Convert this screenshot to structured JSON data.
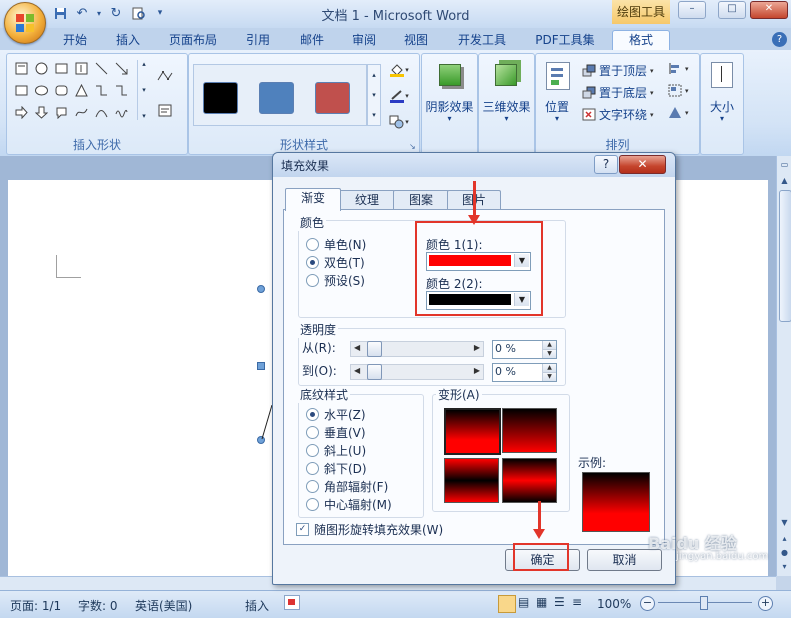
{
  "titlebar": {
    "doc_title": "文档 1 - Microsoft Word",
    "context_tab": "绘图工具",
    "qat_icons": [
      "save-icon",
      "undo-icon",
      "redo-icon",
      "print-preview-icon",
      "customize-qat-icon"
    ],
    "window_buttons": [
      "–",
      "□",
      "✕"
    ]
  },
  "tabs": [
    {
      "label": "开始"
    },
    {
      "label": "插入"
    },
    {
      "label": "页面布局"
    },
    {
      "label": "引用"
    },
    {
      "label": "邮件"
    },
    {
      "label": "审阅"
    },
    {
      "label": "视图"
    },
    {
      "label": "开发工具"
    },
    {
      "label": "PDF工具集"
    },
    {
      "label": "格式",
      "active": true
    }
  ],
  "ribbon": {
    "groups": {
      "insert_shapes": "插入形状",
      "shape_styles": "形状样式",
      "arrange": "排列"
    },
    "shadow_effect": "阴影效果",
    "threed_effect": "三维效果",
    "position": "位置",
    "bring_to_front": "置于顶层",
    "send_to_back": "置于底层",
    "text_wrap": "文字环绕",
    "size": "大小",
    "style_swatches": [
      "#000000",
      "#4f81bd",
      "#c0504d"
    ]
  },
  "dialog": {
    "title": "填充效果",
    "help": "?",
    "close": "✕",
    "tabs": [
      {
        "label": "渐变",
        "active": true
      },
      {
        "label": "纹理"
      },
      {
        "label": "图案"
      },
      {
        "label": "图片"
      }
    ],
    "colors_section": {
      "legend": "颜色",
      "options": [
        {
          "label": "单色(N)",
          "selected": false
        },
        {
          "label": "双色(T)",
          "selected": true
        },
        {
          "label": "预设(S)",
          "selected": false
        }
      ],
      "color1_label": "颜色 1(1):",
      "color1_value": "#ff0000",
      "color2_label": "颜色 2(2):",
      "color2_value": "#000000"
    },
    "transparency": {
      "legend": "透明度",
      "from_label": "从(R):",
      "to_label": "到(O):",
      "from_value": "0 %",
      "to_value": "0 %"
    },
    "shading_styles": {
      "legend": "底纹样式",
      "options": [
        {
          "label": "水平(Z)",
          "selected": true
        },
        {
          "label": "垂直(V)",
          "selected": false
        },
        {
          "label": "斜上(U)",
          "selected": false
        },
        {
          "label": "斜下(D)",
          "selected": false
        },
        {
          "label": "角部辐射(F)",
          "selected": false
        },
        {
          "label": "中心辐射(M)",
          "selected": false
        }
      ]
    },
    "variants_label": "变形(A)",
    "sample_label": "示例:",
    "rotate_checkbox": "随图形旋转填充效果(W)",
    "rotate_checked": true,
    "ok_button": "确定",
    "cancel_button": "取消"
  },
  "statusbar": {
    "page": "页面: 1/1",
    "words": "字数: 0",
    "language": "英语(美国)",
    "insert_mode": "插入",
    "zoom": "100%"
  },
  "watermark": {
    "line1": "Baidu 经验",
    "line2": "jingyan.baidu.com"
  }
}
